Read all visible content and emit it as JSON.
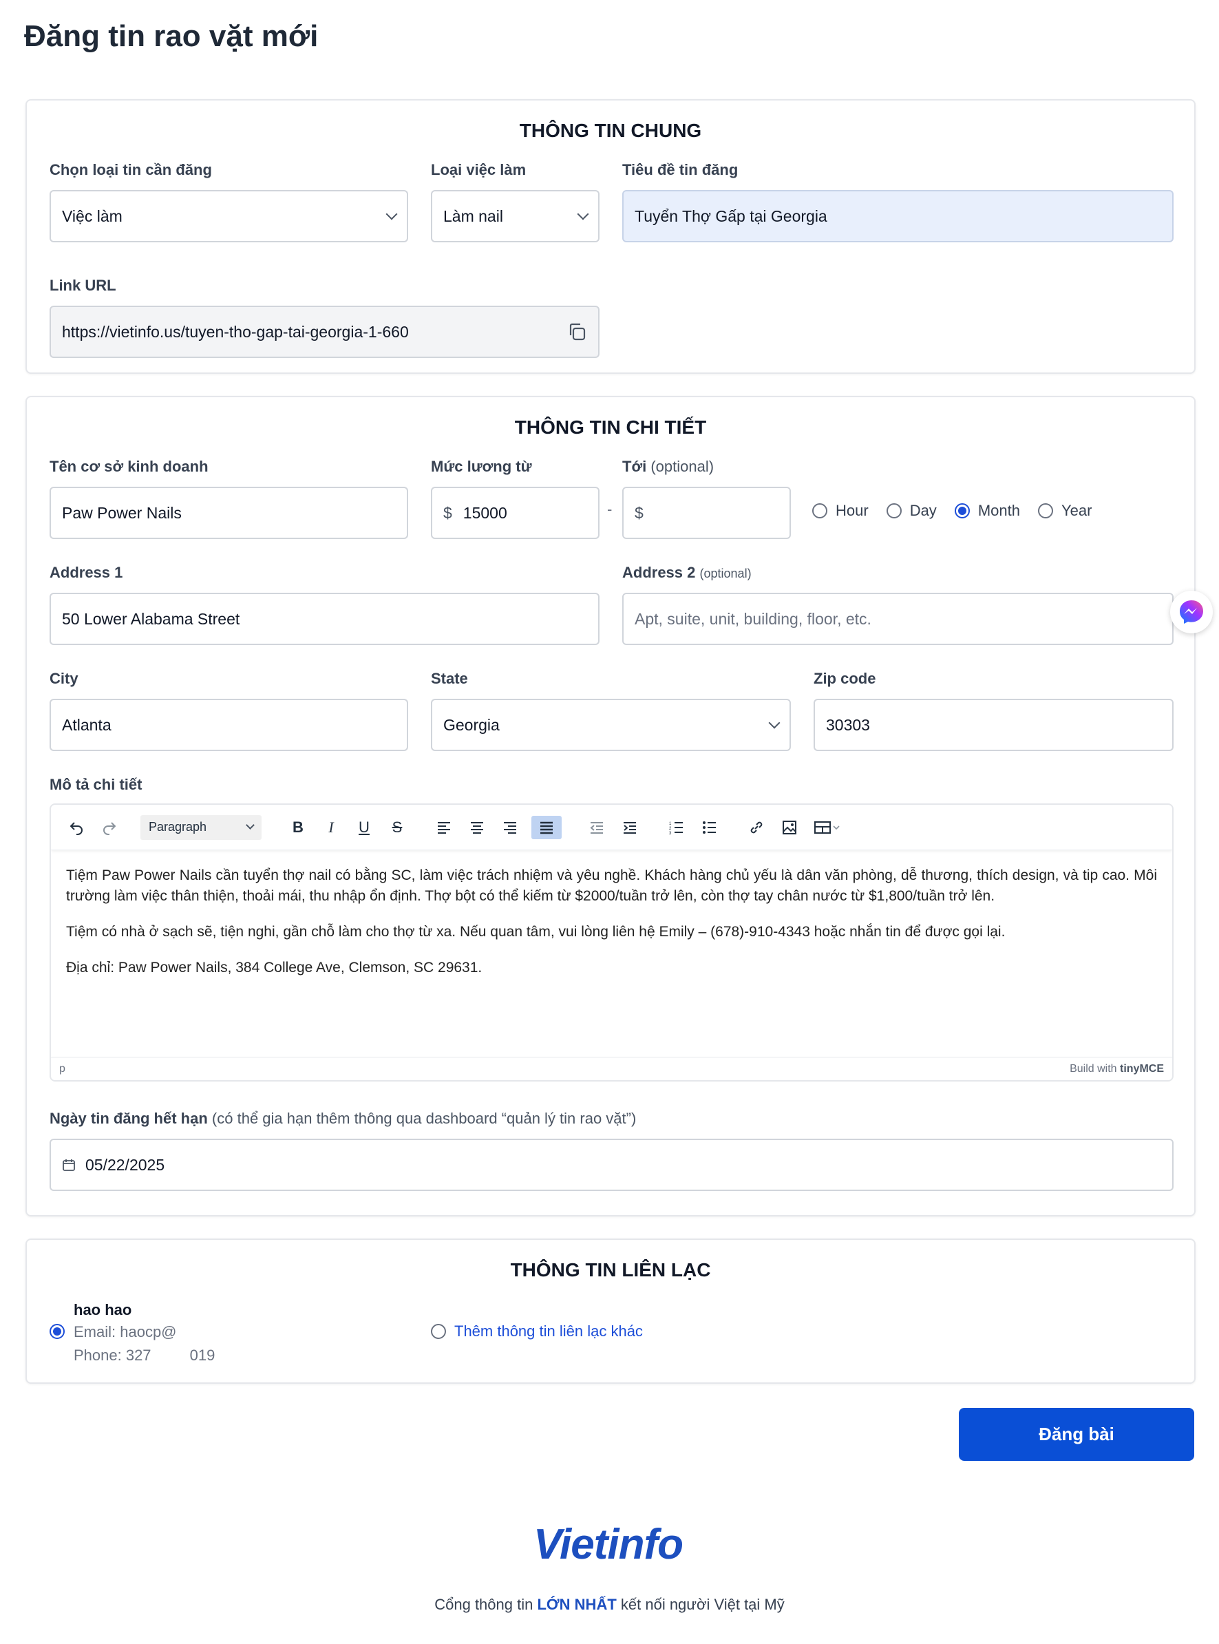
{
  "page": {
    "title": "Đăng tin rao vặt mới"
  },
  "general": {
    "section_title": "THÔNG TIN CHUNG",
    "post_type_label": "Chọn loại tin cần đăng",
    "post_type_value": "Việc làm",
    "job_type_label": "Loại việc làm",
    "job_type_value": "Làm nail",
    "headline_label": "Tiêu đề tin đăng",
    "headline_value": "Tuyển Thợ Gấp tại Georgia",
    "url_label": "Link URL",
    "url_value": "https://vietinfo.us/tuyen-tho-gap-tai-georgia-1-660"
  },
  "detail": {
    "section_title": "THÔNG TIN CHI TIẾT",
    "business_label": "Tên cơ sở kinh doanh",
    "business_value": "Paw Power Nails",
    "salary_from_label": "Mức lương từ",
    "salary_from_value": "15000",
    "salary_to_label": "Tới",
    "salary_to_optional": "(optional)",
    "currency": "$",
    "range_sep": "-",
    "pay_periods": [
      "Hour",
      "Day",
      "Month",
      "Year"
    ],
    "pay_period_selected": "Month",
    "address1_label": "Address 1",
    "address1_value": "50 Lower Alabama Street",
    "address2_label": "Address 2",
    "address2_optional": "(optional)",
    "address2_placeholder": "Apt, suite, unit, building, floor, etc.",
    "city_label": "City",
    "city_value": "Atlanta",
    "state_label": "State",
    "state_value": "Georgia",
    "zip_label": "Zip code",
    "zip_value": "30303",
    "description_label": "Mô tả chi tiết",
    "editor": {
      "block_format": "Paragraph",
      "paragraphs": [
        "Tiệm Paw Power Nails cần tuyển thợ nail có bằng SC, làm việc trách nhiệm và yêu nghề. Khách hàng chủ yếu là dân văn phòng, dễ thương, thích design, và tip cao. Môi trường làm việc thân thiện, thoải mái, thu nhập ổn định. Thợ bột có thể kiếm từ $2000/tuần trở lên, còn thợ tay chân nước từ $1,800/tuần trở lên.",
        "Tiệm có nhà ở sạch sẽ, tiện nghi, gần chỗ làm cho thợ từ xa. Nếu quan tâm, vui lòng liên hệ Emily – (678)-910-4343 hoặc nhắn tin để được gọi lại.",
        "Địa chỉ: Paw Power Nails, 384 College Ave, Clemson, SC 29631."
      ],
      "status_path": "p",
      "branding": "Build with",
      "branding_brand": "tinyMCE"
    },
    "expiry_label": "Ngày tin đăng hết hạn",
    "expiry_note": "(có thể gia hạn thêm thông qua dashboard “quản lý tin rao vặt”)",
    "expiry_value": "05/22/2025"
  },
  "contact": {
    "section_title": "THÔNG TIN LIÊN LẠC",
    "name": "hao hao",
    "email": "Email: haocp@",
    "phone": "Phone: 327",
    "phone_tail": "019",
    "other_option": "Thêm thông tin liên lạc khác"
  },
  "actions": {
    "submit_label": "Đăng bài"
  },
  "footer": {
    "logo": "Vietinfo",
    "tagline_pre": "Cổng thông tin ",
    "tagline_bold": "LỚN NHẤT",
    "tagline_post": " kết nối người Việt tại Mỹ"
  },
  "colors": {
    "primary": "#0a4fd6",
    "highlight_field": "#e8effc",
    "link": "#1d4ed8"
  },
  "icons": [
    "copy-icon",
    "chevron-down-icon",
    "calendar-icon",
    "messenger-icon",
    "undo-icon",
    "redo-icon"
  ]
}
